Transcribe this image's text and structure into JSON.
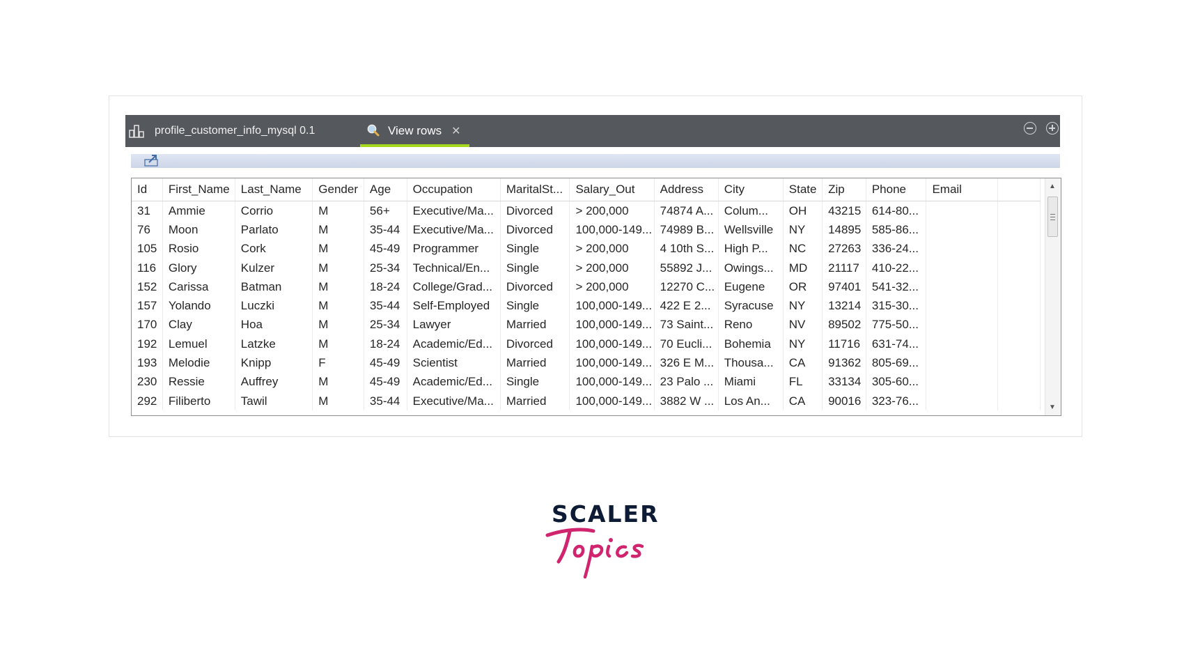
{
  "tabs": {
    "profile_label": "profile_customer_info_mysql 0.1",
    "view_rows_label": "View rows"
  },
  "table": {
    "columns": [
      "Id",
      "First_Name",
      "Last_Name",
      "Gender",
      "Age",
      "Occupation",
      "MaritalSt...",
      "Salary_Out",
      "Address",
      "City",
      "State",
      "Zip",
      "Phone",
      "Email",
      ""
    ],
    "rows": [
      [
        "31",
        "Ammie",
        "Corrio",
        "M",
        "56+",
        "Executive/Ma...",
        "Divorced",
        "> 200,000",
        "74874 A...",
        "Colum...",
        "OH",
        "43215",
        "614-80...",
        "",
        ""
      ],
      [
        "76",
        "Moon",
        "Parlato",
        "M",
        "35-44",
        "Executive/Ma...",
        "Divorced",
        "100,000-149...",
        "74989 B...",
        "Wellsville",
        "NY",
        "14895",
        "585-86...",
        "",
        ""
      ],
      [
        "105",
        "Rosio",
        "Cork",
        "M",
        "45-49",
        "Programmer",
        "Single",
        "> 200,000",
        "4 10th S...",
        "High P...",
        "NC",
        "27263",
        "336-24...",
        "",
        ""
      ],
      [
        "116",
        "Glory",
        "Kulzer",
        "M",
        "25-34",
        "Technical/En...",
        "Single",
        "> 200,000",
        "55892 J...",
        "Owings...",
        "MD",
        "21117",
        "410-22...",
        "",
        ""
      ],
      [
        "152",
        "Carissa",
        "Batman",
        "M",
        "18-24",
        "College/Grad...",
        "Divorced",
        "> 200,000",
        "12270 C...",
        "Eugene",
        "OR",
        "97401",
        "541-32...",
        "",
        ""
      ],
      [
        "157",
        "Yolando",
        "Luczki",
        "M",
        "35-44",
        "Self-Employed",
        "Single",
        "100,000-149...",
        "422 E 2...",
        "Syracuse",
        "NY",
        "13214",
        "315-30...",
        "",
        ""
      ],
      [
        "170",
        "Clay",
        "Hoa",
        "M",
        "25-34",
        "Lawyer",
        "Married",
        "100,000-149...",
        "73 Saint...",
        "Reno",
        "NV",
        "89502",
        "775-50...",
        "",
        ""
      ],
      [
        "192",
        "Lemuel",
        "Latzke",
        "M",
        "18-24",
        "Academic/Ed...",
        "Divorced",
        "100,000-149...",
        "70 Eucli...",
        "Bohemia",
        "NY",
        "11716",
        "631-74...",
        "",
        ""
      ],
      [
        "193",
        "Melodie",
        "Knipp",
        "F",
        "45-49",
        "Scientist",
        "Married",
        "100,000-149...",
        "326 E M...",
        "Thousa...",
        "CA",
        "91362",
        "805-69...",
        "",
        ""
      ],
      [
        "230",
        "Ressie",
        "Auffrey",
        "M",
        "45-49",
        "Academic/Ed...",
        "Single",
        "100,000-149...",
        "23 Palo ...",
        "Miami",
        "FL",
        "33134",
        "305-60...",
        "",
        ""
      ],
      [
        "292",
        "Filiberto",
        "Tawil",
        "M",
        "35-44",
        "Executive/Ma...",
        "Married",
        "100,000-149...",
        "3882 W ...",
        "Los An...",
        "CA",
        "90016",
        "323-76...",
        "",
        ""
      ]
    ]
  },
  "logo": {
    "top_text": "SCALER",
    "script_text": "Topics",
    "colors": {
      "scaler": "#0d1b35",
      "topics": "#d1246f"
    }
  },
  "colors": {
    "titlebar": "#55585d",
    "active_tab_accent": "#a6d81e",
    "toolbar": "#d6dded"
  }
}
